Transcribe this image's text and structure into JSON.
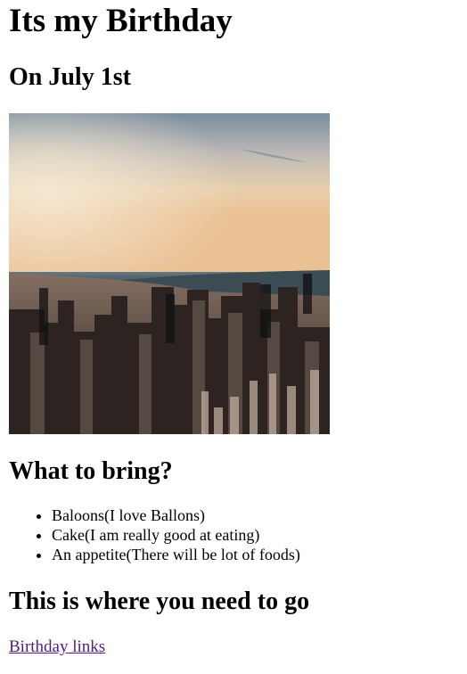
{
  "page": {
    "title": "Its my Birthday",
    "subtitle": "On July 1st",
    "bring_heading": "What to bring?",
    "bring_items": [
      "Baloons(I love Ballons)",
      "Cake(I am really good at eating)",
      "An appetite(There will be lot of foods)"
    ],
    "where_heading": "This is where you need to go",
    "link_text": "Birthday links"
  },
  "colors": {
    "text": "#000000",
    "visited_link": "#551a8b",
    "background": "#ffffff"
  }
}
